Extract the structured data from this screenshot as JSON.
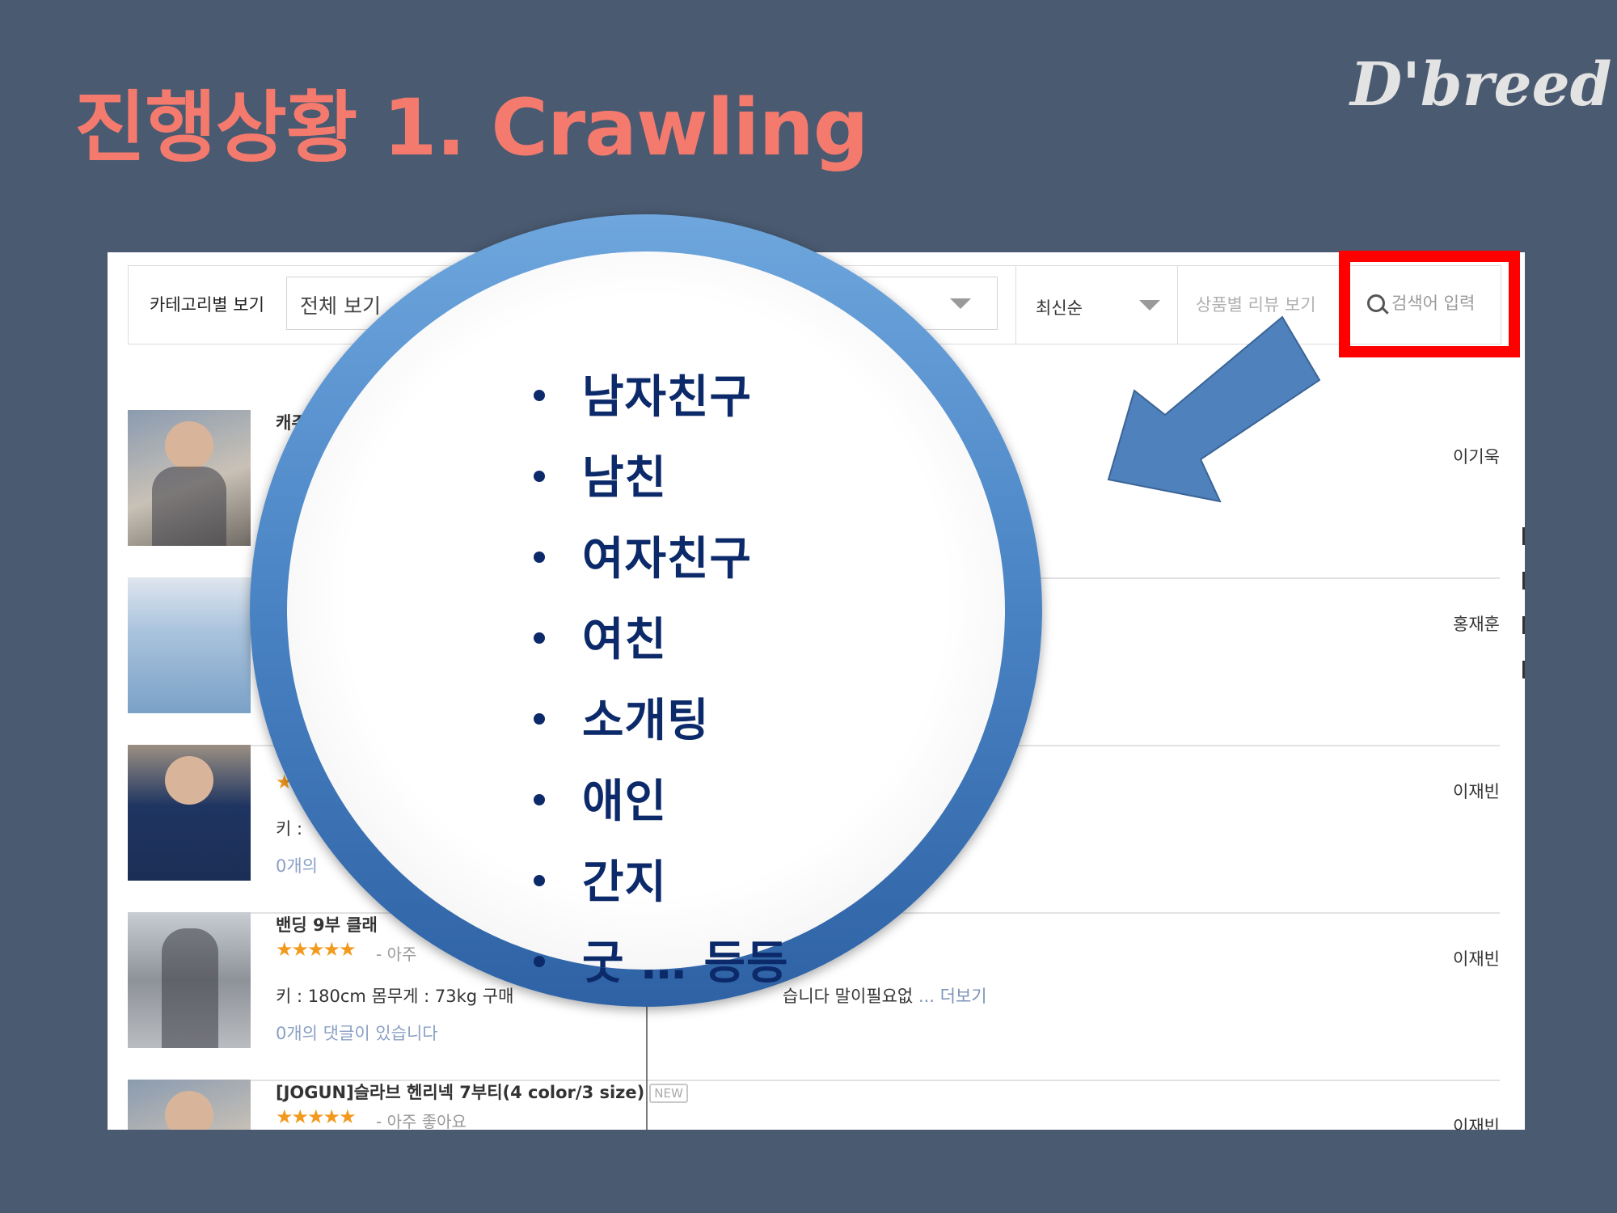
{
  "slide": {
    "title": "진행상황 1. Crawling",
    "logo": "D'breed"
  },
  "filter_bar": {
    "category_label": "카테고리별 보기",
    "category_value": "전체 보기",
    "sort_value": "최신순",
    "review_view_label": "상품별 리뷰 보기",
    "search_placeholder": "검색어 입력"
  },
  "reviews": [
    {
      "title": "캐주",
      "stars": "",
      "rating_text": "",
      "desc": "",
      "comments": "",
      "author": "이기욱"
    },
    {
      "title": "",
      "stars": "",
      "rating_text": "",
      "desc": "",
      "comments": "",
      "author": "홍재훈"
    },
    {
      "title": "",
      "stars": "★",
      "rating_text": "",
      "desc": "키 :",
      "comments": "0개의",
      "author": "이재빈"
    },
    {
      "title": "밴딩 9부 클래",
      "stars": "★★★★★",
      "rating_text": "- 아주",
      "desc": "키 : 180cm 몸무게 : 73kg 구매",
      "desc_tail": "습니다 말이필요없",
      "more": "... 더보기",
      "comments": "0개의 댓글이 있습니다",
      "author": "이재빈"
    },
    {
      "title": "[JOGUN]슬라브 헨리넥 7부티(4 color/3 size)",
      "badge": "NEW",
      "stars": "★★★★★",
      "rating_text": "- 아주 좋아요",
      "author": "이재빈"
    }
  ],
  "keywords": [
    "남자친구",
    "남친",
    "여자친구",
    "여친",
    "소개팅",
    "애인",
    "간지",
    "굿 … 등등"
  ],
  "colors": {
    "background": "#4a5a70",
    "title": "#f47a6e",
    "keyword_text": "#0c2a6a",
    "highlight": "#ff0000",
    "arrow": "#4f81bd",
    "ring": "#4c86c6"
  },
  "icons": {
    "search": "magnifying-glass",
    "dropdown": "triangle-down"
  }
}
